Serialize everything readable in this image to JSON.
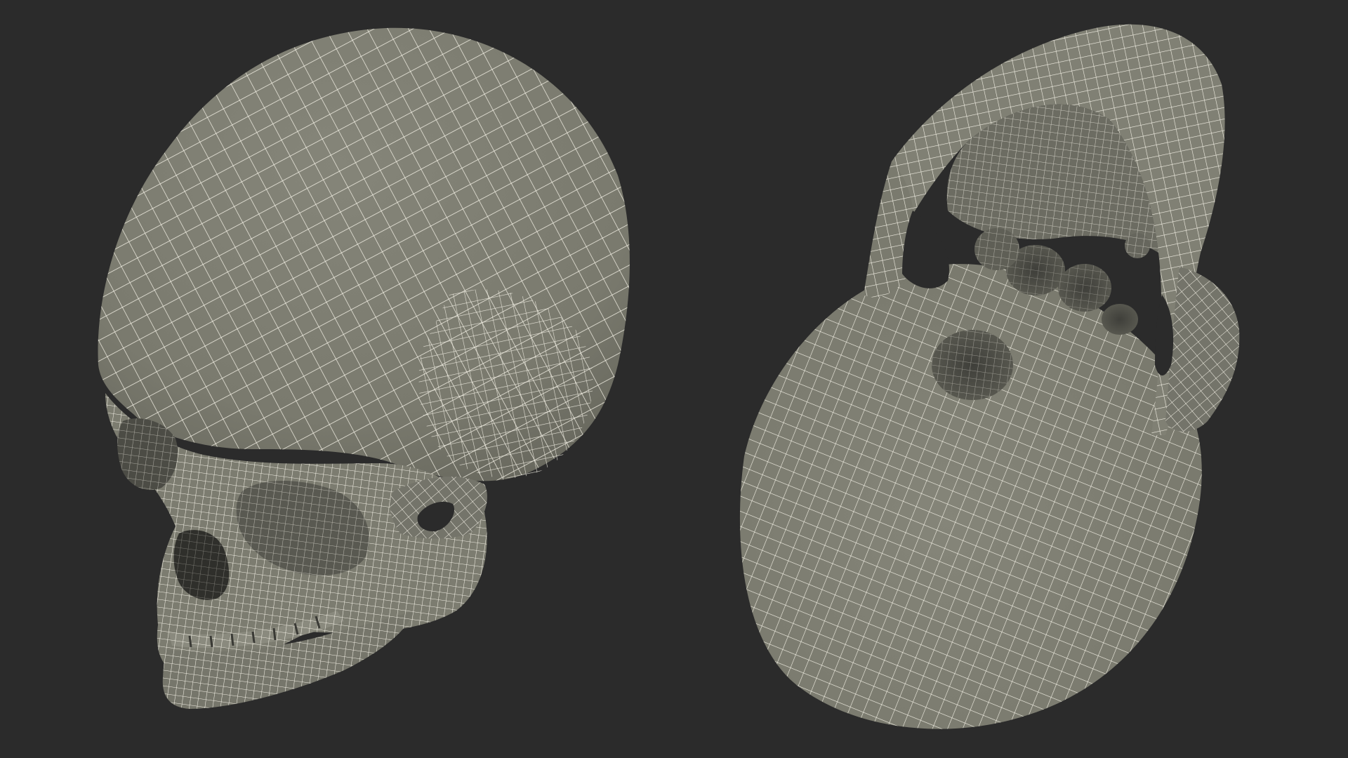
{
  "scene": {
    "background_color": "#2b2b2b",
    "mesh_surface_color": "#7f7f73",
    "mesh_shadow_color": "#5e5e55",
    "mesh_cavity_color": "#45453f",
    "wireframe_color": "#f4f1e6"
  },
  "views": [
    {
      "name": "skull-front-three-quarter-view",
      "description_visible_text": ""
    },
    {
      "name": "skull-cranial-base-view",
      "description_visible_text": ""
    }
  ]
}
